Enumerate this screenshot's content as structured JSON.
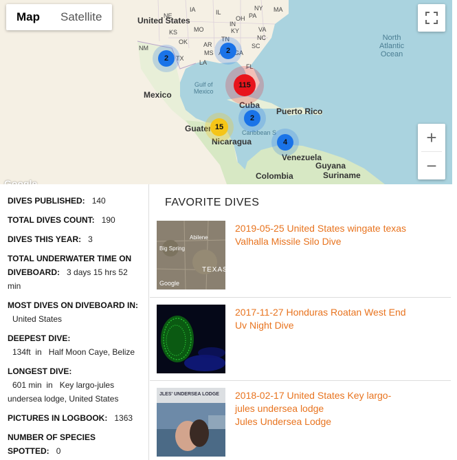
{
  "map": {
    "type_tabs": [
      "Map",
      "Satellite"
    ],
    "active_tab": "Map",
    "zoom_in": "+",
    "zoom_out": "−",
    "google": "Google",
    "labels": {
      "united_states": "United States",
      "mexico": "Mexico",
      "cuba": "Cuba",
      "puerto_rico": "Puerto Rico",
      "guatemala": "Guaten",
      "nicaragua": "Nicaragua",
      "venezuela": "Venezuela",
      "colombia": "Colombia",
      "guyana": "Guyana",
      "suriname": "Suriname",
      "gulf": "Gulf of\nMexico",
      "caribbean": "Caribbean S",
      "atlantic": "North\nAtlantic\nOcean",
      "states": [
        "IA",
        "IL",
        "OH",
        "PA",
        "NY",
        "MA",
        "NE",
        "IN",
        "MO",
        "KY",
        "VA",
        "KS",
        "TN",
        "NC",
        "OK",
        "AR",
        "SC",
        "NM",
        "MS",
        "AL",
        "GA",
        "TX",
        "LA",
        "FL"
      ]
    },
    "clusters": [
      {
        "count": "2",
        "color": "#1a73e8"
      },
      {
        "count": "2",
        "color": "#1a73e8"
      },
      {
        "count": "115",
        "color": "#e8141b"
      },
      {
        "count": "2",
        "color": "#1a73e8"
      },
      {
        "count": "15",
        "color": "#f5c518"
      },
      {
        "count": "4",
        "color": "#1a73e8"
      }
    ]
  },
  "stats": {
    "published_label": "DIVES PUBLISHED:",
    "published_value": "140",
    "total_label": "TOTAL DIVES COUNT:",
    "total_value": "190",
    "year_label": "DIVES THIS YEAR:",
    "year_value": "3",
    "time_label_1": "TOTAL UNDERWATER TIME ON",
    "time_label_2": "DIVEBOARD:",
    "time_value_1": "3 days 15 hrs 52",
    "time_value_2": "min",
    "most_label": "MOST DIVES ON DIVEBOARD IN:",
    "most_value": "United States",
    "deepest_label": "DEEPEST DIVE:",
    "deepest_value": "134ft  in   Half Moon Caye, Belize",
    "longest_label": "LONGEST DIVE:",
    "longest_value_1": "601 min  in   Key largo-jules",
    "longest_value_2": "undersea lodge, United States",
    "pictures_label": "PICTURES IN LOGBOOK:",
    "pictures_value": "1363",
    "species_label_1": "NUMBER OF SPECIES",
    "species_label_2": "SPOTTED:",
    "species_value": "0"
  },
  "favorites": {
    "title": "FAVORITE DIVES",
    "dives": [
      {
        "title_1": "2019-05-25 United States wingate texas",
        "title_2": "Valhalla Missile Silo Dive",
        "title_3": "",
        "thumb_labels": [
          "Abilene",
          "Big Spring",
          "TEXAS",
          "Google"
        ]
      },
      {
        "title_1": "2017-11-27 Honduras Roatan West End",
        "title_2": "Uv Night Dive",
        "title_3": ""
      },
      {
        "title_1": "2018-02-17 United States Key largo-",
        "title_2": "jules undersea lodge",
        "title_3": "Jules Undersea Lodge",
        "thumb_labels": [
          "JLES' UNDERSEA LODGE"
        ]
      }
    ]
  }
}
